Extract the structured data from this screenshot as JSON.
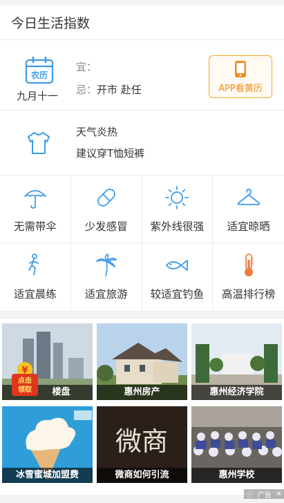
{
  "header": {
    "title": "今日生活指数"
  },
  "calendar": {
    "icon_label": "农历",
    "date": "九月十一",
    "yi_key": "宜：",
    "yi_value": "",
    "ji_key": "忌：",
    "ji_value": "开市 赴任",
    "app_button": "APP看黄历",
    "accent": "#f5a623",
    "icon_color": "#3d9be9"
  },
  "dress": {
    "line1": "天气炎热",
    "line2": "建议穿T恤短裤",
    "icon": "tshirt-icon"
  },
  "indices": [
    {
      "label": "无需带伞",
      "icon": "umbrella-icon"
    },
    {
      "label": "少发感冒",
      "icon": "pill-icon"
    },
    {
      "label": "紫外线很强",
      "icon": "sun-icon"
    },
    {
      "label": "适宜晾晒",
      "icon": "hanger-icon"
    },
    {
      "label": "适宜晨练",
      "icon": "running-icon"
    },
    {
      "label": "适宜旅游",
      "icon": "palm-tree-icon"
    },
    {
      "label": "较适宜钓鱼",
      "icon": "fish-icon"
    },
    {
      "label": "高温排行榜",
      "icon": "thermometer-icon"
    }
  ],
  "ads": [
    {
      "caption": "楼盘"
    },
    {
      "caption": "惠州房产"
    },
    {
      "caption": "惠州经济学院"
    },
    {
      "caption": "冰雪蜜城加盟费"
    },
    {
      "caption": "微商如何引流",
      "overlay_text": "微商"
    },
    {
      "caption": "惠州学校"
    }
  ],
  "coupon": {
    "line1": "点击",
    "line2": "领取"
  },
  "adbar": {
    "label": "广告",
    "close": "✕"
  }
}
